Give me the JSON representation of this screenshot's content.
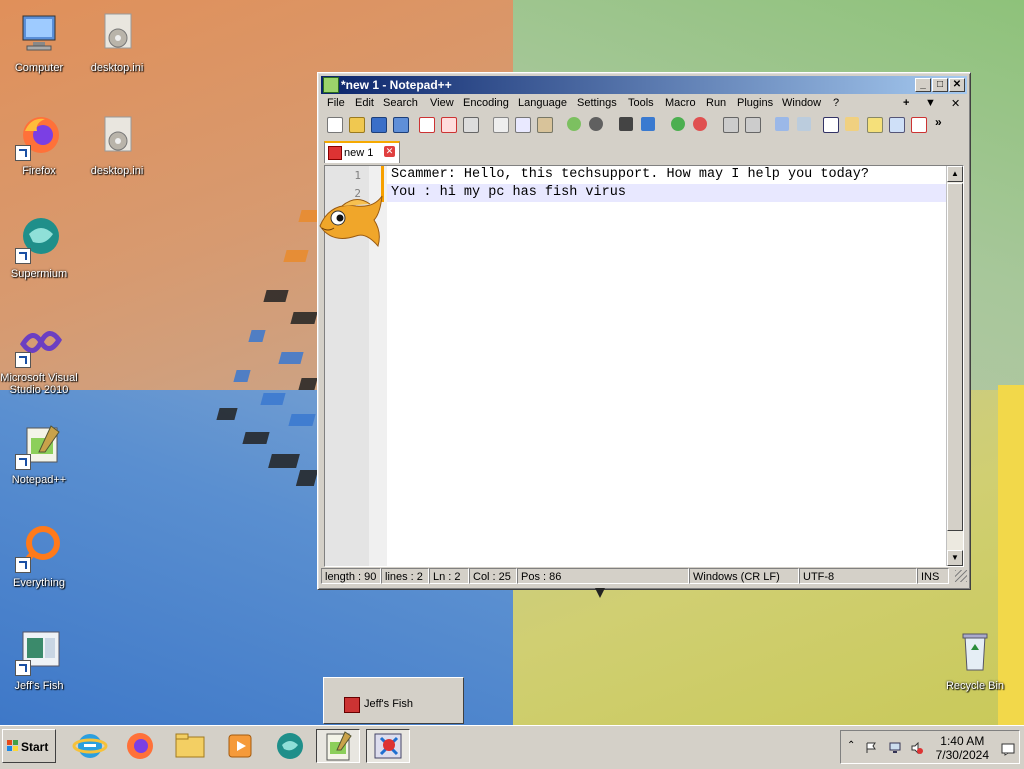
{
  "desktop": {
    "icons": [
      {
        "label": "Computer"
      },
      {
        "label": "desktop.ini"
      },
      {
        "label": "Firefox"
      },
      {
        "label": "desktop.ini"
      },
      {
        "label": "Supermium"
      },
      {
        "label": "Microsoft Visual Studio 2010"
      },
      {
        "label": "Notepad++"
      },
      {
        "label": "Everything"
      },
      {
        "label": "Jeff's Fish"
      },
      {
        "label": "Recycle Bin"
      }
    ]
  },
  "window": {
    "title": "*new 1 - Notepad++",
    "menu": [
      "File",
      "Edit",
      "Search",
      "View",
      "Encoding",
      "Language",
      "Settings",
      "Tools",
      "Macro",
      "Run",
      "Plugins",
      "Window",
      "?"
    ],
    "menu_right": [
      "+",
      "▼",
      "✕"
    ],
    "tab": {
      "label": "new 1",
      "close": "✕"
    },
    "lines": [
      {
        "num": "1",
        "text": "Scammer: Hello, this techsupport. How may I help you today?"
      },
      {
        "num": "2",
        "text": "You : hi my pc has fish virus"
      }
    ],
    "status": {
      "length": "length : 90",
      "lines": "lines : 2",
      "ln": "Ln : 2",
      "col": "Col : 25",
      "pos": "Pos : 86",
      "eol": "Windows (CR LF)",
      "encoding": "UTF-8",
      "mode": "INS"
    }
  },
  "jeffs_fish_window": {
    "label": "Jeff's Fish"
  },
  "taskbar": {
    "start_label": "Start",
    "clock_time": "1:40 AM",
    "clock_date": "7/30/2024"
  },
  "colors": {
    "titlebar_start": "#0a246a",
    "titlebar_end": "#a6caf0",
    "current_line": "#e8e8ff",
    "change_marker": "#f7a000"
  }
}
